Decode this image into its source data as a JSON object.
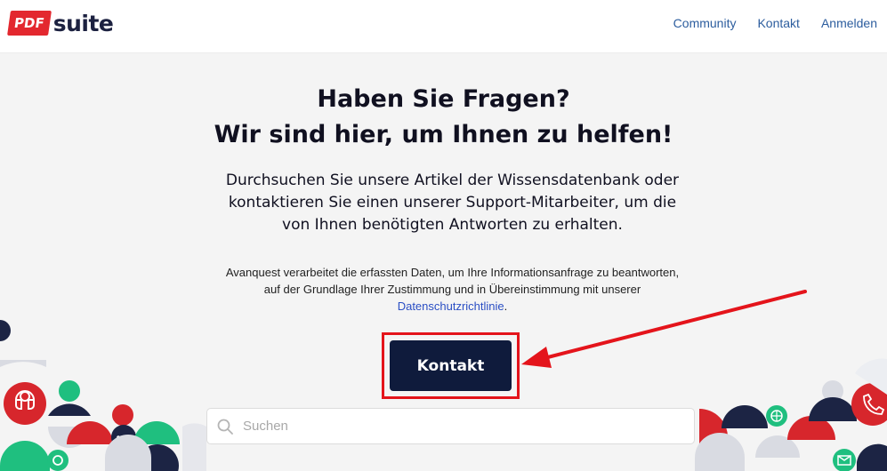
{
  "header": {
    "logo_badge": "PDF",
    "logo_word": "suite",
    "nav": [
      "Community",
      "Kontakt",
      "Anmelden"
    ]
  },
  "hero": {
    "title_line1": "Haben Sie Fragen?",
    "title_line2": "Wir sind hier, um Ihnen zu helfen!",
    "sub_line1": "Durchsuchen Sie unsere Artikel der Wissensdatenbank oder",
    "sub_line2": "kontaktieren Sie einen unserer Support-Mitarbeiter, um die",
    "sub_line3": "von Ihnen benötigten Antworten zu erhalten."
  },
  "notice": {
    "line1": "Avanquest verarbeitet die erfassten Daten, um Ihre Informationsanfrage zu beantworten,",
    "line2": "auf der Grundlage Ihrer Zustimmung und in Übereinstimmung mit unserer",
    "link": "Datenschutzrichtlinie",
    "after_link": "."
  },
  "contact_button": "Kontakt",
  "search": {
    "placeholder": "Suchen"
  },
  "colors": {
    "brand_red": "#e3282f",
    "navy": "#0f1b3c",
    "green": "#1fbf7f",
    "link": "#2c5d9e"
  }
}
